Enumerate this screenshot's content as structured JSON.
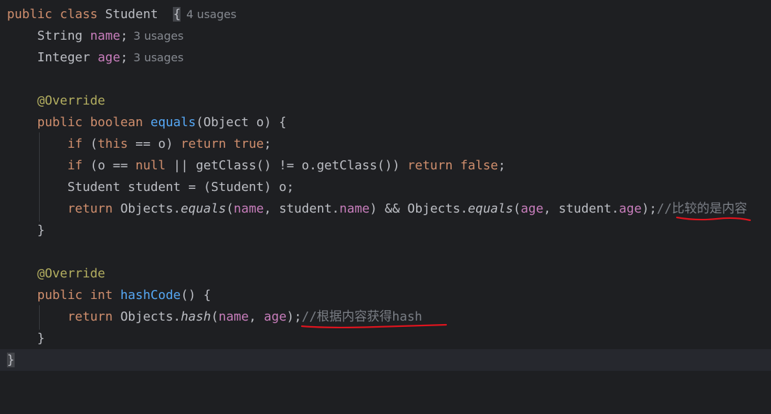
{
  "class_decl": {
    "code": "public class Student  {",
    "kw": "public class ",
    "name": "Student  ",
    "brace": "{",
    "usages": "4 usages"
  },
  "field_name": {
    "type": "String ",
    "name": "name",
    "semi": ";",
    "usages": "3 usages"
  },
  "field_age": {
    "type": "Integer ",
    "name": "age",
    "semi": ";",
    "usages": "3 usages"
  },
  "equals_method": {
    "annotation": "@Override",
    "sig_kw": "public boolean ",
    "sig_name": "equals",
    "sig_rest": "(Object o) {",
    "l1_kw1": "if",
    "l1_a": " (",
    "l1_this": "this",
    "l1_b": " == o) ",
    "l1_ret": "return",
    "l1_sp": " ",
    "l1_true": "true",
    "l1_end": ";",
    "l2_kw1": "if",
    "l2_a": " (o == ",
    "l2_null": "null",
    "l2_b": " || getClass() != o.getClass()) ",
    "l2_ret": "return",
    "l2_sp": " ",
    "l2_false": "false",
    "l2_end": ";",
    "l3": "Student student = (Student) o;",
    "l4_ret": "return",
    "l4_a": " Objects.",
    "l4_eq1": "equals",
    "l4_b": "(",
    "l4_name1": "name",
    "l4_c": ", student.",
    "l4_name2": "name",
    "l4_d": ") && Objects.",
    "l4_eq2": "equals",
    "l4_e": "(",
    "l4_age1": "age",
    "l4_f": ", student.",
    "l4_age2": "age",
    "l4_g": ");",
    "l4_comment": "//比较的是内容",
    "close": "}"
  },
  "hashcode_method": {
    "annotation": "@Override",
    "sig_kw": "public int ",
    "sig_name": "hashCode",
    "sig_rest": "() {",
    "l1_ret": "return",
    "l1_a": " Objects.",
    "l1_hash": "hash",
    "l1_b": "(",
    "l1_name": "name",
    "l1_c": ", ",
    "l1_age": "age",
    "l1_d": ");",
    "l1_comment": "//根据内容获得hash",
    "close": "}"
  },
  "class_close": "}",
  "colors": {
    "background": "#1e1f22",
    "keyword": "#cf8e6d",
    "field": "#c77dbb",
    "method": "#56a8f5",
    "annotation": "#b3ae60",
    "comment": "#7a7e85",
    "underline_mark": "#e0141e"
  }
}
